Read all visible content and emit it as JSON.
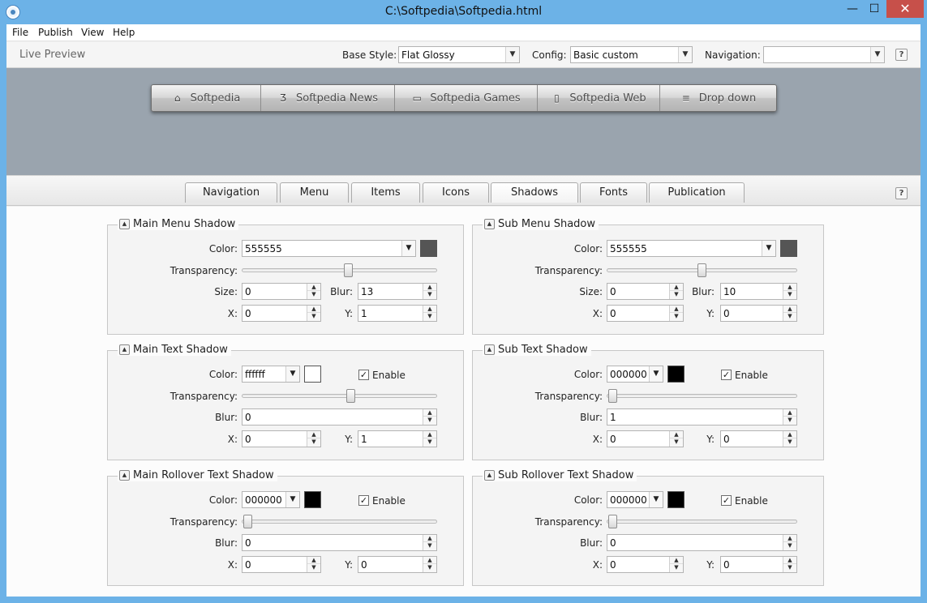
{
  "window": {
    "title": "C:\\Softpedia\\Softpedia.html",
    "minimize_glyph": "—",
    "maximize_glyph": "☐",
    "close_glyph": "✕"
  },
  "menubar": {
    "items": [
      "File",
      "Publish",
      "View",
      "Help"
    ]
  },
  "toolbar": {
    "live_preview": "Live Preview",
    "base_style_label": "Base Style:",
    "base_style_value": "Flat Glossy",
    "config_label": "Config:",
    "config_value": "Basic custom",
    "navigation_label": "Navigation:",
    "navigation_value": "",
    "help": "?"
  },
  "preview": {
    "nav_items": [
      {
        "label": "Softpedia",
        "icon": "home-icon",
        "glyph": "⌂"
      },
      {
        "label": "Softpedia News",
        "icon": "css3-icon",
        "glyph": "Ʒ"
      },
      {
        "label": "Softpedia Games",
        "icon": "monitor-icon",
        "glyph": "▭"
      },
      {
        "label": "Softpedia Web",
        "icon": "mobile-icon",
        "glyph": "▯"
      },
      {
        "label": "Drop down",
        "icon": "list-icon",
        "glyph": "≡"
      }
    ]
  },
  "tabs": {
    "items": [
      "Navigation",
      "Menu",
      "Items",
      "Icons",
      "Shadows",
      "Fonts",
      "Publication"
    ],
    "active": "Shadows",
    "help": "?"
  },
  "labels": {
    "color": "Color:",
    "transparency": "Transparency:",
    "size": "Size:",
    "blur": "Blur:",
    "x": "X:",
    "y": "Y:",
    "enable": "Enable",
    "check": "✓",
    "arrow_down": "▼",
    "arrow_up": "▲"
  },
  "groups": {
    "main_menu": {
      "title": "Main Menu Shadow",
      "color": "555555",
      "swatch": "#555555",
      "transparency": 0.55,
      "size": "0",
      "blur": "13",
      "x": "0",
      "y": "1"
    },
    "sub_menu": {
      "title": "Sub Menu Shadow",
      "color": "555555",
      "swatch": "#555555",
      "transparency": 0.5,
      "size": "0",
      "blur": "10",
      "x": "0",
      "y": "0"
    },
    "main_text": {
      "title": "Main Text Shadow",
      "color": "ffffff",
      "swatch": "#ffffff",
      "enabled": true,
      "transparency": 0.56,
      "blur": "0",
      "x": "0",
      "y": "1"
    },
    "sub_text": {
      "title": "Sub Text Shadow",
      "color": "000000",
      "swatch": "#000000",
      "enabled": true,
      "transparency": 0.0,
      "blur": "1",
      "x": "0",
      "y": "0"
    },
    "main_rollover": {
      "title": "Main Rollover Text Shadow",
      "color": "000000",
      "swatch": "#000000",
      "enabled": true,
      "transparency": 0.0,
      "blur": "0",
      "x": "0",
      "y": "0"
    },
    "sub_rollover": {
      "title": "Sub Rollover Text Shadow",
      "color": "000000",
      "swatch": "#000000",
      "enabled": true,
      "transparency": 0.0,
      "blur": "0",
      "x": "0",
      "y": "0"
    }
  },
  "colors": {
    "titlebar": "#6cb2e7",
    "close_button": "#c7504a",
    "preview_bg": "#9aa4ae"
  }
}
